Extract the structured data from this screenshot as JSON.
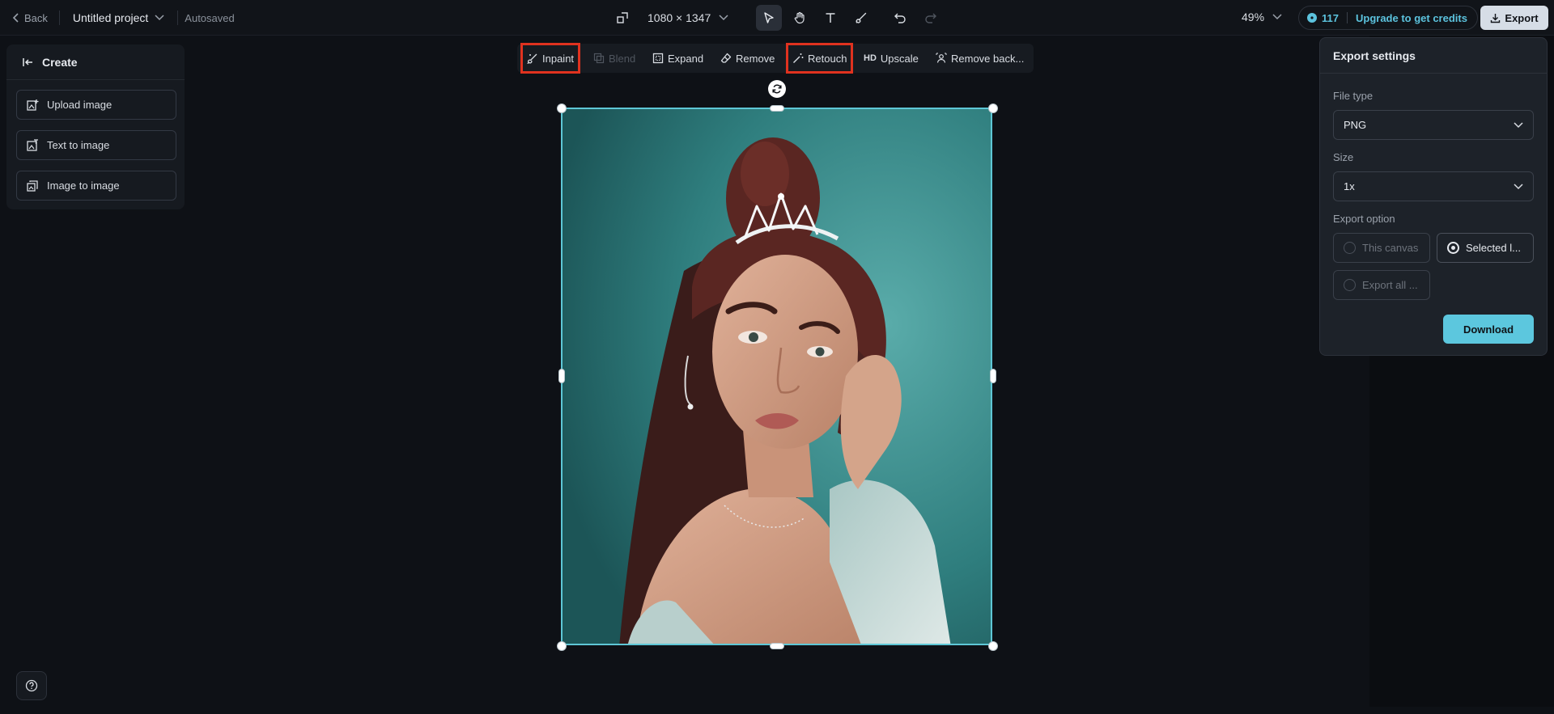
{
  "topbar": {
    "back_label": "Back",
    "project_name": "Untitled project",
    "autosaved": "Autosaved",
    "canvas_size": "1080 × 1347",
    "zoom": "49%",
    "credits": "117",
    "upgrade_label": "Upgrade to get credits",
    "export_label": "Export"
  },
  "left_panel": {
    "title": "Create",
    "items": [
      {
        "label": "Upload image",
        "icon": "upload-image-icon"
      },
      {
        "label": "Text to image",
        "icon": "text-to-image-icon"
      },
      {
        "label": "Image to image",
        "icon": "image-to-image-icon"
      }
    ]
  },
  "canvas_toolbar": {
    "items": [
      {
        "label": "Inpaint",
        "state": "highlighted"
      },
      {
        "label": "Blend",
        "state": "disabled"
      },
      {
        "label": "Expand",
        "state": "normal"
      },
      {
        "label": "Remove",
        "state": "normal"
      },
      {
        "label": "Retouch",
        "state": "highlighted"
      },
      {
        "label": "Upscale",
        "badge": "HD",
        "state": "normal"
      },
      {
        "label": "Remove back...",
        "state": "normal"
      }
    ]
  },
  "export_panel": {
    "title": "Export settings",
    "file_type_label": "File type",
    "file_type_value": "PNG",
    "size_label": "Size",
    "size_value": "1x",
    "export_option_label": "Export option",
    "options": [
      {
        "label": "This canvas",
        "selected": false
      },
      {
        "label": "Selected l...",
        "selected": true
      },
      {
        "label": "Export all ...",
        "selected": false
      }
    ],
    "download_label": "Download"
  },
  "colors": {
    "accent": "#5cc7de",
    "highlight_box": "#e0321f",
    "selection": "#5ec7d6",
    "background": "#0e1116"
  }
}
